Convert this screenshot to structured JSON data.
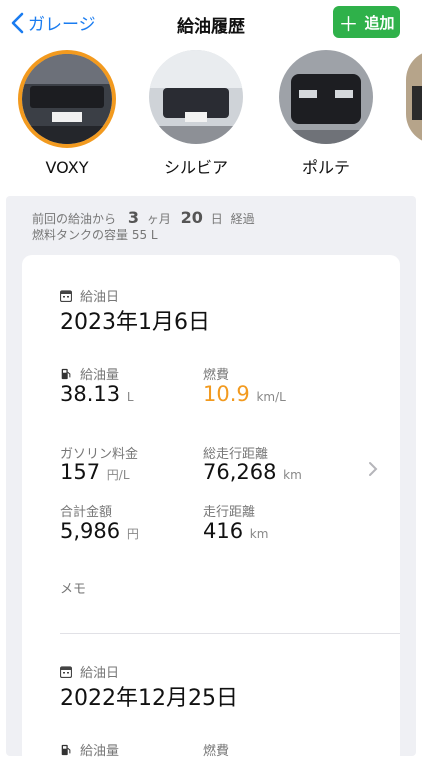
{
  "nav": {
    "back_label": "ガレージ",
    "title": "給油履歴",
    "add_label": "追加"
  },
  "cars": [
    {
      "name": "VOXY",
      "selected": true
    },
    {
      "name": "シルビア",
      "selected": false
    },
    {
      "name": "ポルテ",
      "selected": false
    }
  ],
  "summary": {
    "prefix": "前回の給油から",
    "months": "3",
    "months_unit": "ヶ月",
    "days": "20",
    "days_unit": "日",
    "suffix": "経過",
    "tank": "燃料タンクの容量 55 L"
  },
  "records": [
    {
      "date_label": "給油日",
      "date": "2023年1月6日",
      "amount_label": "給油量",
      "amount": "38.13",
      "amount_unit": "L",
      "fuel_eff_label": "燃費",
      "fuel_eff": "10.9",
      "fuel_eff_unit": "km/L",
      "price_label": "ガソリン料金",
      "price": "157",
      "price_unit": "円/L",
      "odo_label": "総走行距離",
      "odo": "76,268",
      "odo_unit": "km",
      "total_label": "合計金額",
      "total": "5,986",
      "total_unit": "円",
      "dist_label": "走行距離",
      "dist": "416",
      "dist_unit": "km",
      "memo_label": "メモ"
    },
    {
      "date_label": "給油日",
      "date": "2022年12月25日",
      "amount_label": "給油量",
      "fuel_eff_label": "燃費"
    }
  ],
  "colors": {
    "accent": "#1a7cf0",
    "add_button": "#2fb14a",
    "selected_ring": "#f29a1f",
    "fuel_eff": "#f29a1f"
  }
}
